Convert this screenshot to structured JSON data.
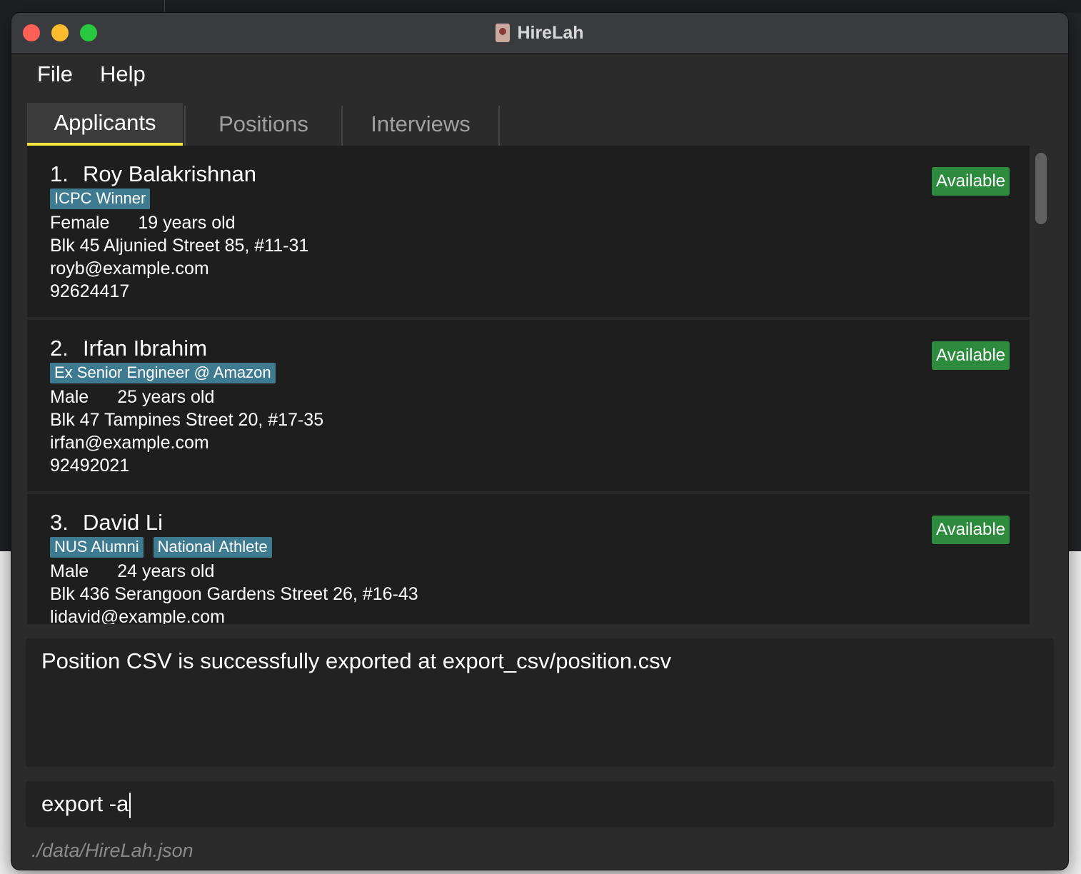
{
  "window": {
    "title": "HireLah"
  },
  "menu": {
    "items": [
      "File",
      "Help"
    ]
  },
  "tabs": [
    {
      "label": "Applicants",
      "active": true
    },
    {
      "label": "Positions",
      "active": false
    },
    {
      "label": "Interviews",
      "active": false
    }
  ],
  "applicants": [
    {
      "index": "1.",
      "name": "Roy Balakrishnan",
      "tags": [
        "ICPC Winner"
      ],
      "gender": "Female",
      "age": "19 years old",
      "address": "Blk 45 Aljunied Street 85, #11-31",
      "email": "royb@example.com",
      "phone": "92624417",
      "status": "Available"
    },
    {
      "index": "2.",
      "name": "Irfan Ibrahim",
      "tags": [
        "Ex Senior Engineer @ Amazon"
      ],
      "gender": "Male",
      "age": "25 years old",
      "address": "Blk 47 Tampines Street 20, #17-35",
      "email": "irfan@example.com",
      "phone": "92492021",
      "status": "Available"
    },
    {
      "index": "3.",
      "name": "David Li",
      "tags": [
        "NUS Alumni",
        "National Athlete"
      ],
      "gender": "Male",
      "age": "24 years old",
      "address": "Blk 436 Serangoon Gardens Street 26, #16-43",
      "email": "lidavid@example.com",
      "phone": "",
      "status": "Available"
    }
  ],
  "result": {
    "message": "Position CSV is successfully exported at export_csv/position.csv"
  },
  "command": {
    "value": "export -a"
  },
  "statusbar": {
    "path": "./data/HireLah.json"
  },
  "colors": {
    "tab_active_underline": "#f2e53d",
    "tag_bg": "#3e7b91",
    "status_available_bg": "#2d8b3e"
  }
}
